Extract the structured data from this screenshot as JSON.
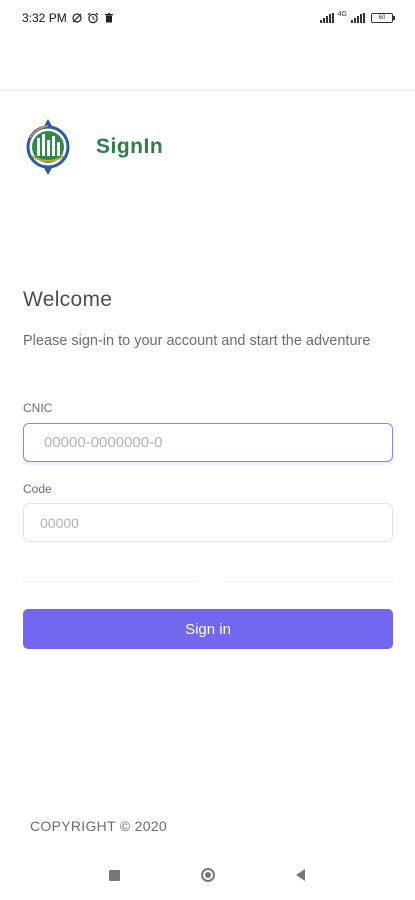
{
  "status_bar": {
    "time": "3:32 PM",
    "network_label": "4G",
    "battery_level": "60",
    "icons": [
      "sync-off-icon",
      "alarm-icon",
      "trash-icon",
      "signal-icon",
      "signal-icon",
      "battery-icon"
    ]
  },
  "brand": {
    "title": "SignIn",
    "logo_icon": "organization-logo-icon",
    "title_color": "#2f7d4a"
  },
  "welcome": {
    "heading": "Welcome",
    "subtitle": "Please sign-in to your account and start the adventure"
  },
  "form": {
    "cnic": {
      "label": "CNIC",
      "value": "",
      "placeholder": "00000-0000000-0"
    },
    "code": {
      "label": "Code",
      "value": "",
      "placeholder": "00000"
    },
    "submit_label": "Sign in",
    "accent_color": "#7367f0"
  },
  "footer": {
    "copyright": "COPYRIGHT © 2020"
  },
  "nav_bar": {
    "icons": [
      "recent-apps-icon",
      "home-icon",
      "back-icon"
    ]
  }
}
